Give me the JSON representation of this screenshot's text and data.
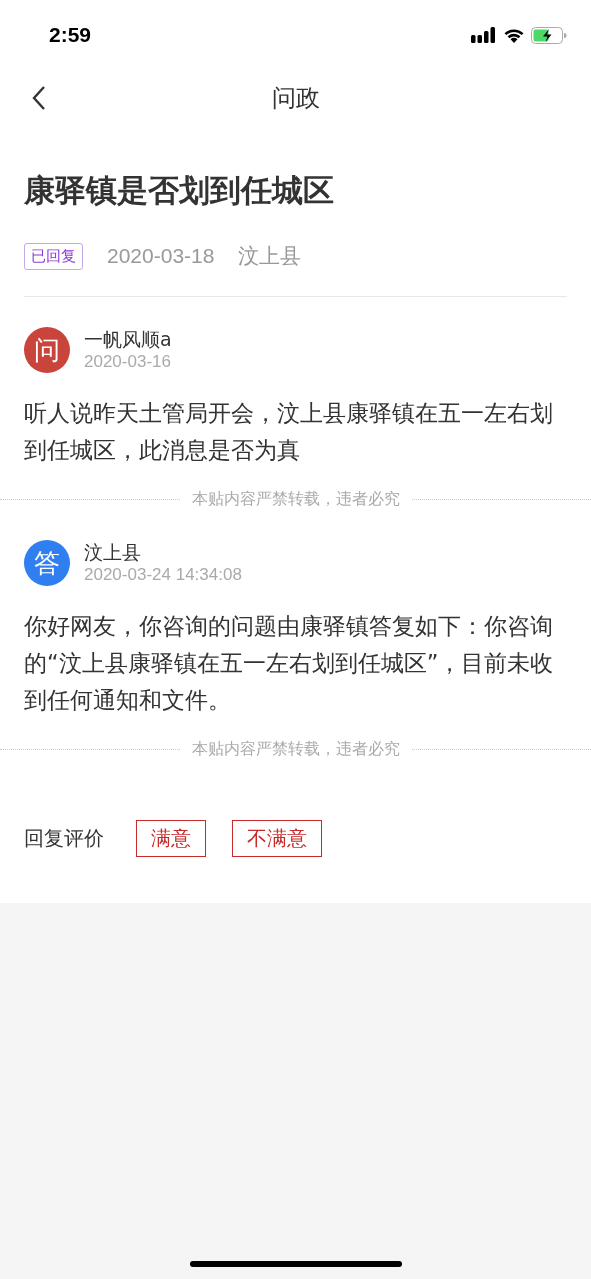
{
  "status_bar": {
    "time": "2:59"
  },
  "nav": {
    "title": "问政"
  },
  "question": {
    "title": "康驿镇是否划到任城区",
    "status": "已回复",
    "date": "2020-03-18",
    "county": "汶上县"
  },
  "posts": [
    {
      "avatar": "问",
      "color": "#c9443a",
      "author": "一帆风顺a",
      "time": "2020-03-16",
      "body": "听人说昨天土管局开会，汶上县康驿镇在五一左右划到任城区，此消息是否为真",
      "notice": "本贴内容严禁转载，违者必究"
    },
    {
      "avatar": "答",
      "color": "#2f7ff0",
      "author": "汶上县",
      "time": "2020-03-24 14:34:08",
      "body": "你好网友，你咨询的问题由康驿镇答复如下：你咨询的“汶上县康驿镇在五一左右划到任城区”，目前未收到任何通知和文件。",
      "notice": "本贴内容严禁转载，违者必究"
    }
  ],
  "rating": {
    "label": "回复评价",
    "options": [
      "满意",
      "不满意"
    ]
  }
}
